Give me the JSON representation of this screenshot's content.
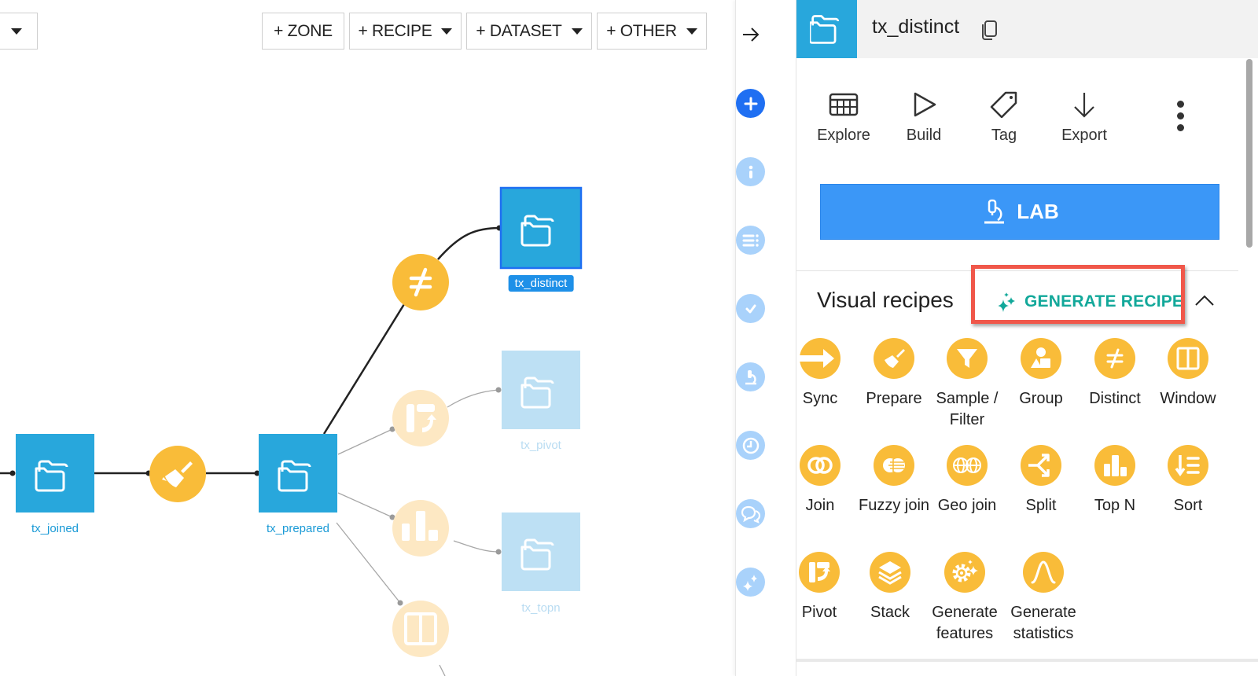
{
  "canvas": {
    "toolbar": {
      "left_dropdown": "",
      "buttons": [
        {
          "label": "+ ZONE",
          "has_caret": false
        },
        {
          "label": "+ RECIPE",
          "has_caret": true
        },
        {
          "label": "+ DATASET",
          "has_caret": true
        },
        {
          "label": "+ OTHER",
          "has_caret": true
        }
      ]
    },
    "datasets": [
      {
        "id": "tx_joined",
        "label": "tx_joined",
        "state": "normal"
      },
      {
        "id": "tx_prepared",
        "label": "tx_prepared",
        "state": "normal"
      },
      {
        "id": "tx_distinct",
        "label": "tx_distinct",
        "state": "selected"
      },
      {
        "id": "tx_pivot",
        "label": "tx_pivot",
        "state": "faded"
      },
      {
        "id": "tx_topn",
        "label": "tx_topn",
        "state": "faded"
      }
    ],
    "recipes": [
      {
        "id": "prepare",
        "icon": "broom-icon",
        "state": "normal"
      },
      {
        "id": "distinct",
        "icon": "not-equal-icon",
        "state": "normal"
      },
      {
        "id": "pivot",
        "icon": "pivot-icon",
        "state": "faded"
      },
      {
        "id": "topn",
        "icon": "top-n-icon",
        "state": "faded"
      },
      {
        "id": "window",
        "icon": "window-icon",
        "state": "faded"
      }
    ],
    "colors": {
      "dataset": "#28a7dc",
      "dataset_faded": "#bde0f4",
      "recipe": "#f9bc39",
      "recipe_faded": "#fde8c3",
      "selected_border": "#1f6ff2"
    }
  },
  "rail": {
    "collapse_icon": "arrow-right-icon",
    "items": [
      {
        "icon": "plus-icon",
        "name": "actions",
        "active": true
      },
      {
        "icon": "info-icon",
        "name": "details",
        "active": false
      },
      {
        "icon": "list-icon",
        "name": "schema",
        "active": false
      },
      {
        "icon": "check-icon",
        "name": "checks",
        "active": false
      },
      {
        "icon": "microscope-icon",
        "name": "lab",
        "active": false
      },
      {
        "icon": "clock-icon",
        "name": "timeline",
        "active": false
      },
      {
        "icon": "chat-icon",
        "name": "discussions",
        "active": false
      },
      {
        "icon": "sparkle-icon",
        "name": "ai-assistant",
        "active": false
      }
    ]
  },
  "panel": {
    "header": {
      "title": "tx_distinct",
      "icon": "dataset-folder-icon"
    },
    "actions": [
      {
        "label": "Explore",
        "icon": "table-icon"
      },
      {
        "label": "Build",
        "icon": "play-icon"
      },
      {
        "label": "Tag",
        "icon": "tag-icon"
      },
      {
        "label": "Export",
        "icon": "download-arrow-icon"
      }
    ],
    "lab_button": "LAB",
    "visual_recipes": {
      "title": "Visual recipes",
      "generate_label": "GENERATE RECIPE",
      "items": [
        {
          "label": "Sync",
          "icon": "sync-arrow-icon"
        },
        {
          "label": "Prepare",
          "icon": "broom-icon"
        },
        {
          "label": "Sample / Filter",
          "icon": "funnel-icon"
        },
        {
          "label": "Group",
          "icon": "shapes-icon"
        },
        {
          "label": "Distinct",
          "icon": "not-equal-icon"
        },
        {
          "label": "Window",
          "icon": "window-icon"
        },
        {
          "label": "Join",
          "icon": "join-circles-icon"
        },
        {
          "label": "Fuzzy join",
          "icon": "fuzzy-join-icon"
        },
        {
          "label": "Geo join",
          "icon": "geo-join-icon"
        },
        {
          "label": "Split",
          "icon": "split-arrows-icon"
        },
        {
          "label": "Top N",
          "icon": "top-n-icon"
        },
        {
          "label": "Sort",
          "icon": "sort-icon"
        },
        {
          "label": "Pivot",
          "icon": "pivot-icon"
        },
        {
          "label": "Stack",
          "icon": "layers-icon"
        },
        {
          "label": "Generate features",
          "icon": "gear-sparkle-icon"
        },
        {
          "label": "Generate statistics",
          "icon": "bell-curve-icon"
        }
      ]
    },
    "colors": {
      "lab": "#3b97f7",
      "generate": "#12a89a",
      "highlight": "#f0574a",
      "recipe": "#f9bc39"
    }
  }
}
